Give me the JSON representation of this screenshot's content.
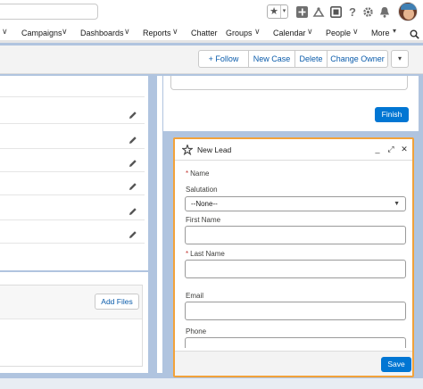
{
  "header": {
    "search_value": "",
    "icons": [
      "favorites-star-icon",
      "add-icon",
      "trailhead-icon",
      "setup-assistant-icon",
      "help-icon",
      "gear-icon",
      "notifications-bell-icon"
    ]
  },
  "nav": {
    "items": [
      {
        "label": "Campaigns"
      },
      {
        "label": "Dashboards"
      },
      {
        "label": "Reports"
      },
      {
        "label": "Chatter"
      },
      {
        "label": "Groups"
      },
      {
        "label": "Calendar"
      },
      {
        "label": "People"
      },
      {
        "label": "More"
      }
    ]
  },
  "actions": {
    "follow": "Follow",
    "follow_icon": "+",
    "new_case": "New Case",
    "delete": "Delete",
    "change_owner": "Change Owner",
    "more_caret": "▾"
  },
  "left": {
    "add_files": "Add Files"
  },
  "right": {
    "finish": "Finish"
  },
  "composer": {
    "title": "New Lead",
    "fields": {
      "name_section": "Name",
      "salutation_label": "Salutation",
      "salutation_value": "--None--",
      "first_name_label": "First Name",
      "first_name_value": "",
      "last_name_label": "Last Name",
      "last_name_value": "",
      "email_label": "Email",
      "email_value": "",
      "phone_label": "Phone",
      "phone_value": ""
    },
    "required_mark": "*",
    "save": "Save"
  },
  "colors": {
    "brand_blue": "#0176d3",
    "link_blue": "#0b5cab",
    "focus_orange": "#f2a23a",
    "background": "#b0c4df"
  }
}
